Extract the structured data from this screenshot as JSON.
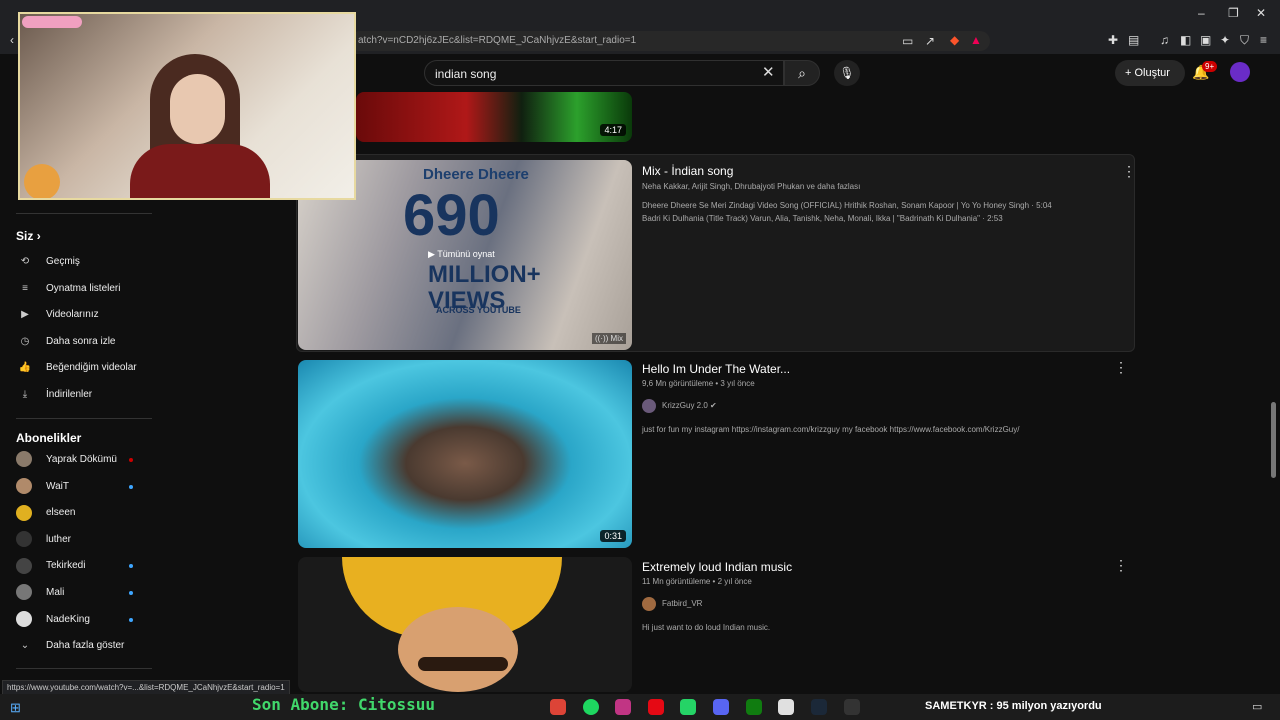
{
  "browser": {
    "url": "atch?v=nCD2hj6zJEc&list=RDQME_JCaNhjvzE&start_radio=1",
    "status_url": "https://www.youtube.com/watch?v=...&list=RDQME_JCaNhjvzE&start_radio=1"
  },
  "header": {
    "search_value": "indian song",
    "create_label": "Oluştur",
    "notif_badge": "9+"
  },
  "sidebar": {
    "you_label": "Siz",
    "you_items": [
      {
        "label": "Geçmiş",
        "icon": "history-icon"
      },
      {
        "label": "Oynatma listeleri",
        "icon": "playlists-icon"
      },
      {
        "label": "Videolarınız",
        "icon": "your-videos-icon"
      },
      {
        "label": "Daha sonra izle",
        "icon": "watch-later-icon"
      },
      {
        "label": "Beğendiğim videolar",
        "icon": "liked-icon"
      },
      {
        "label": "İndirilenler",
        "icon": "download-icon"
      }
    ],
    "subs_label": "Abonelikler",
    "subs": [
      {
        "label": "Yaprak Dökümü",
        "color": "#8a7a6a",
        "live": true
      },
      {
        "label": "WaiT",
        "color": "#b08a6a",
        "dot": true
      },
      {
        "label": "elseen",
        "color": "#e0b020",
        "dot": false
      },
      {
        "label": "luther",
        "color": "#333333",
        "dot": false
      },
      {
        "label": "Tekirkedi",
        "color": "#444444",
        "dot": true
      },
      {
        "label": "Mali",
        "color": "#777777",
        "dot": true
      },
      {
        "label": "NadeKing",
        "color": "#dddddd",
        "dot": true
      }
    ],
    "show_more": "Daha fazla göster"
  },
  "results": {
    "top_duration": "4:17",
    "mix": {
      "title": "Mix - İndian song",
      "artists": "Neha Kakkar, Arijit Singh, Dhrubajyoti Phukan ve daha fazlası",
      "line1": "Dheere Dheere Se Meri Zindagi Video Song (OFFICIAL) Hrithik Roshan, Sonam Kapoor | Yo Yo Honey Singh · 5:04",
      "line2": "Badri Ki Dulhania (Title Track) Varun, Alia, Tanishk, Neha, Monali, Ikka | \"Badrinath Ki Dulhania\" · 2:53",
      "play_all": "Tümünü oynat",
      "thumb_title": "Dheere Dheere",
      "thumb_big": "690",
      "thumb_views": "MILLION+ VIEWS",
      "thumb_across": "ACROSS YOUTUBE",
      "mix_badge": "Mix"
    },
    "videos": [
      {
        "title": "Hello Im Under The Water...",
        "meta": "9,6 Mn görüntüleme • 3 yıl önce",
        "channel": "KrizzGuy 2.0",
        "desc": "just for fun my instagram https://instagram.com/krizzguy my facebook https://www.facebook.com/KrizzGuy/",
        "duration": "0:31"
      },
      {
        "title": "Extremely loud Indian music",
        "meta": "11 Mn görüntüleme • 2 yıl önce",
        "channel": "Fatbird_VR",
        "desc": "Hi just want to do loud Indian music."
      }
    ]
  },
  "overlay": {
    "ticker": "Son Abone: Citossuu",
    "ticker2": "SAMETKYR : 95 milyon yazıyordu"
  }
}
